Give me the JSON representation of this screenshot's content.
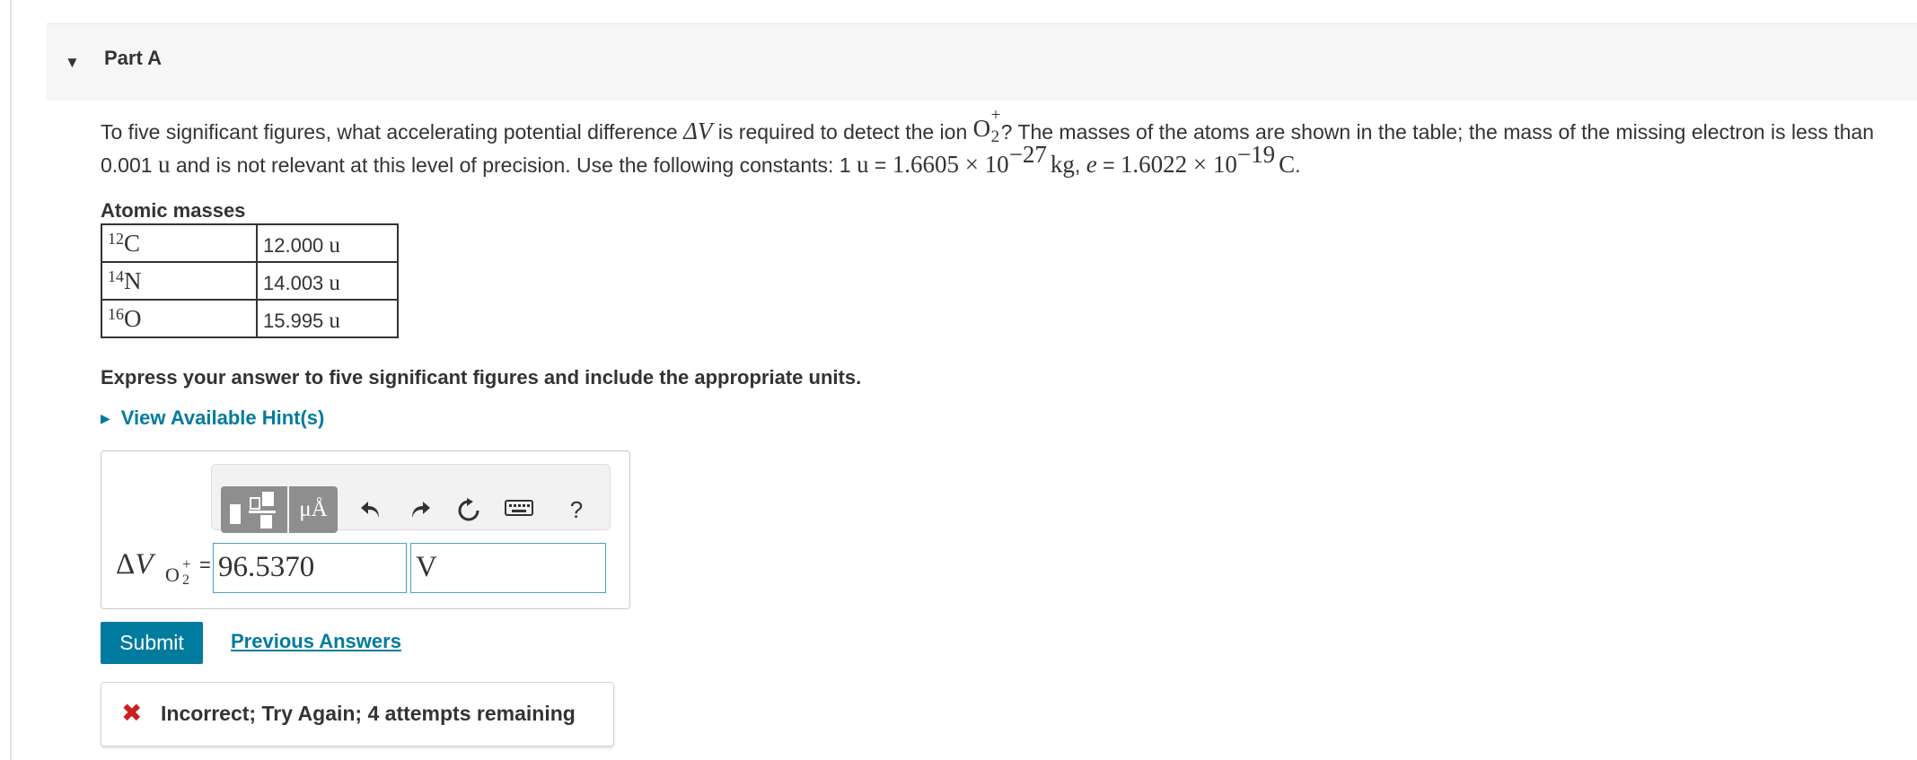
{
  "part": {
    "title": "Part A"
  },
  "problem": {
    "seg1": "To five significant figures, what accelerating potential difference ",
    "symbol_dv": "ΔV",
    "seg2": " is required to detect the ion ",
    "ion_symbol": "O",
    "ion_subscript": "2",
    "ion_charge": "+",
    "seg3": "? The masses of the atoms are shown in the table; the mass of the missing electron is less than 0.001 ",
    "unit_u": "u",
    "seg4": " and is not relevant at this level of precision. Use the following constants: 1 ",
    "unit_u2": "u",
    "seg5": " = ",
    "const_u_mantissa": "1.6605 × 10",
    "const_u_exp": "−27",
    "const_u_unit": "kg",
    "seg6": ", ",
    "const_e_symbol": "e",
    "seg7": " = ",
    "const_e_mantissa": "1.6022 × 10",
    "const_e_exp": "−19",
    "const_e_unit": "C",
    "seg8": "."
  },
  "masses_table": {
    "caption": "Atomic masses",
    "rows": [
      {
        "mass_number": "12",
        "element": "C",
        "value": "12.000",
        "unit": "u"
      },
      {
        "mass_number": "14",
        "element": "N",
        "value": "14.003",
        "unit": "u"
      },
      {
        "mass_number": "16",
        "element": "O",
        "value": "15.995",
        "unit": "u"
      }
    ]
  },
  "instructions": "Express your answer to five significant figures and include the appropriate units.",
  "hints_label": "View Available Hint(s)",
  "toolbar": {
    "units_label": "μÅ",
    "help_label": "?"
  },
  "answer": {
    "lhs_symbol": "ΔV",
    "lhs_delta": "Δ",
    "lhs_v": "V",
    "lhs_sub_symbol": "O",
    "lhs_sub_charge": "+",
    "lhs_sub_index": "2",
    "equals": "=",
    "value": "96.5370",
    "units": "V"
  },
  "submit_label": "Submit",
  "previous_answers_label": "Previous Answers",
  "feedback": {
    "icon": "✖",
    "message": "Incorrect; Try Again; 4 attempts remaining"
  },
  "colors": {
    "link": "#007b9e",
    "error": "#cc1f1f",
    "field_border": "#4a9fc2"
  }
}
